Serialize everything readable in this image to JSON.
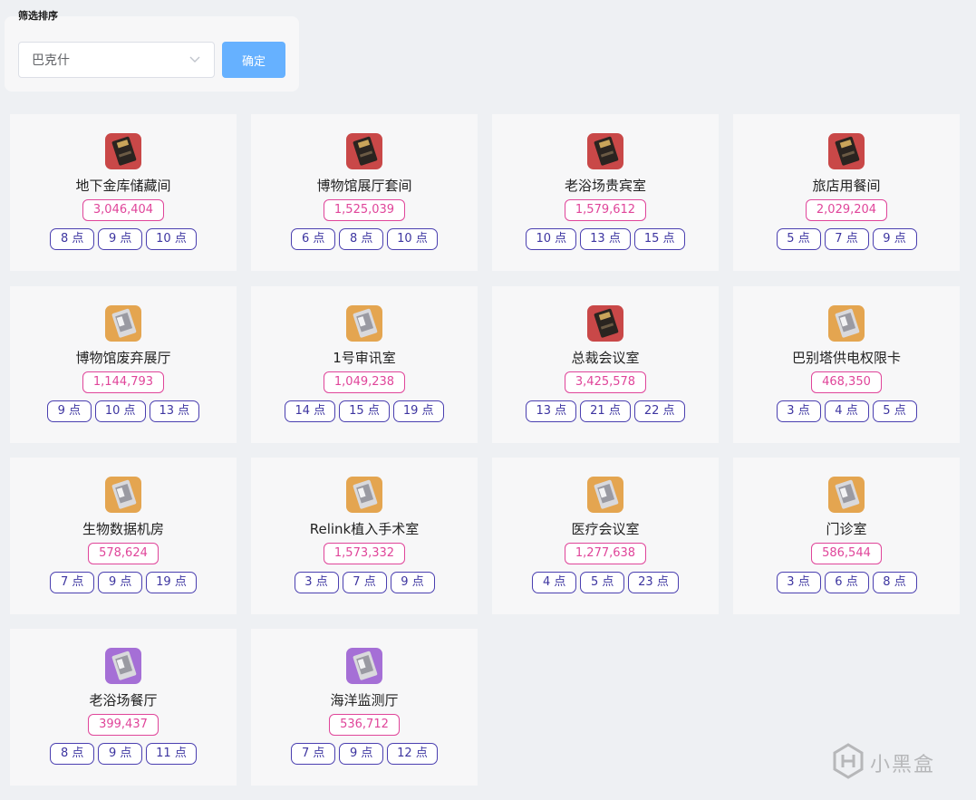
{
  "filter": {
    "title": "筛选排序",
    "select_value": "巴克什",
    "confirm_label": "确定"
  },
  "cards": [
    {
      "name": "地下金库储藏间",
      "value": "3,046,404",
      "icon": "red-keycard-icon",
      "tags": [
        "8 点",
        "9 点",
        "10 点"
      ]
    },
    {
      "name": "博物馆展厅套间",
      "value": "1,525,039",
      "icon": "red-keycard-icon",
      "tags": [
        "6 点",
        "8 点",
        "10 点"
      ]
    },
    {
      "name": "老浴场贵宾室",
      "value": "1,579,612",
      "icon": "red-keycard-icon",
      "tags": [
        "10 点",
        "13 点",
        "15 点"
      ]
    },
    {
      "name": "旅店用餐间",
      "value": "2,029,204",
      "icon": "red-keycard-icon",
      "tags": [
        "5 点",
        "7 点",
        "9 点"
      ]
    },
    {
      "name": "博物馆废弃展厅",
      "value": "1,144,793",
      "icon": "gold-keycard-icon",
      "tags": [
        "9 点",
        "10 点",
        "13 点"
      ]
    },
    {
      "name": "1号审讯室",
      "value": "1,049,238",
      "icon": "gold-keycard-icon",
      "tags": [
        "14 点",
        "15 点",
        "19 点"
      ]
    },
    {
      "name": "总裁会议室",
      "value": "3,425,578",
      "icon": "red-keycard-icon",
      "tags": [
        "13 点",
        "21 点",
        "22 点"
      ]
    },
    {
      "name": "巴别塔供电权限卡",
      "value": "468,350",
      "icon": "gold-keycard-icon",
      "tags": [
        "3 点",
        "4 点",
        "5 点"
      ]
    },
    {
      "name": "生物数据机房",
      "value": "578,624",
      "icon": "gold-keycard-icon",
      "tags": [
        "7 点",
        "9 点",
        "19 点"
      ]
    },
    {
      "name": "Relink植入手术室",
      "value": "1,573,332",
      "icon": "gold-keycard-icon",
      "tags": [
        "3 点",
        "7 点",
        "9 点"
      ]
    },
    {
      "name": "医疗会议室",
      "value": "1,277,638",
      "icon": "gold-keycard-icon",
      "tags": [
        "4 点",
        "5 点",
        "23 点"
      ]
    },
    {
      "name": "门诊室",
      "value": "586,544",
      "icon": "gold-keycard-icon",
      "tags": [
        "3 点",
        "6 点",
        "8 点"
      ]
    },
    {
      "name": "老浴场餐厅",
      "value": "399,437",
      "icon": "purple-keycard-icon",
      "tags": [
        "8 点",
        "9 点",
        "11 点"
      ]
    },
    {
      "name": "海洋监测厅",
      "value": "536,712",
      "icon": "purple-keycard-icon",
      "tags": [
        "7 点",
        "9 点",
        "12 点"
      ]
    }
  ],
  "watermark": {
    "text": "小黑盒",
    "icon": "heybox-logo-icon"
  },
  "colors": {
    "value_pink": "#e0459a",
    "tag_indigo": "#4a3fb0",
    "confirm_blue": "#66b1ff",
    "icon_red": "#c94848",
    "icon_gold": "#e4a550",
    "icon_purple": "#a56fd6"
  }
}
